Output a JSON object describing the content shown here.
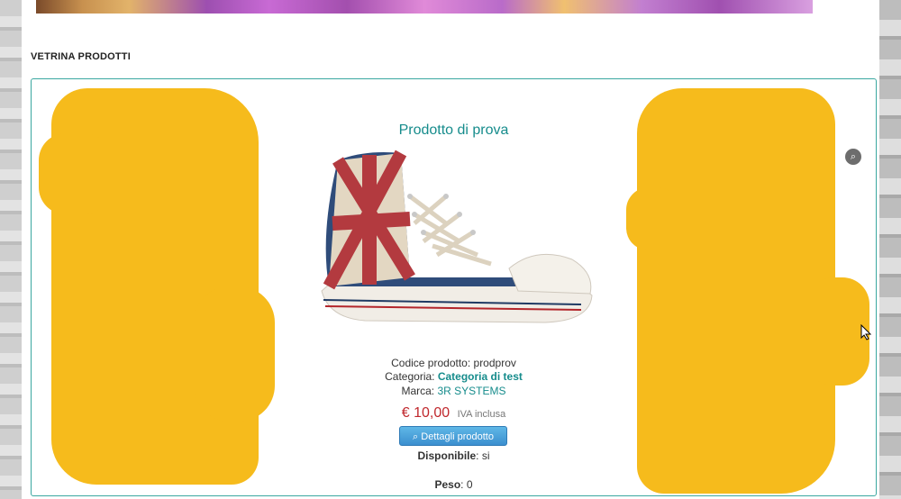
{
  "section_title": "VETRINA PRODOTTI",
  "product": {
    "title": "Prodotto di prova",
    "code_label": "Codice prodotto:",
    "code_value": "prodprov",
    "category_label": "Categoria:",
    "category_value": "Categoria di test",
    "brand_label": "Marca:",
    "brand_value": "3R SYSTEMS",
    "price": "€ 10,00",
    "vat_note": "IVA inclusa",
    "details_button": "Dettagli prodotto",
    "available_label": "Disponibile",
    "available_value": ": si",
    "weight_label": "Peso",
    "weight_value": ": 0"
  },
  "icons": {
    "zoom": "zoom-icon",
    "magnifier": "magnifier-icon"
  },
  "colors": {
    "accent": "#168c8c",
    "price": "#c0282d",
    "button": "#3b8fcf",
    "redaction": "#f6bb1c"
  }
}
